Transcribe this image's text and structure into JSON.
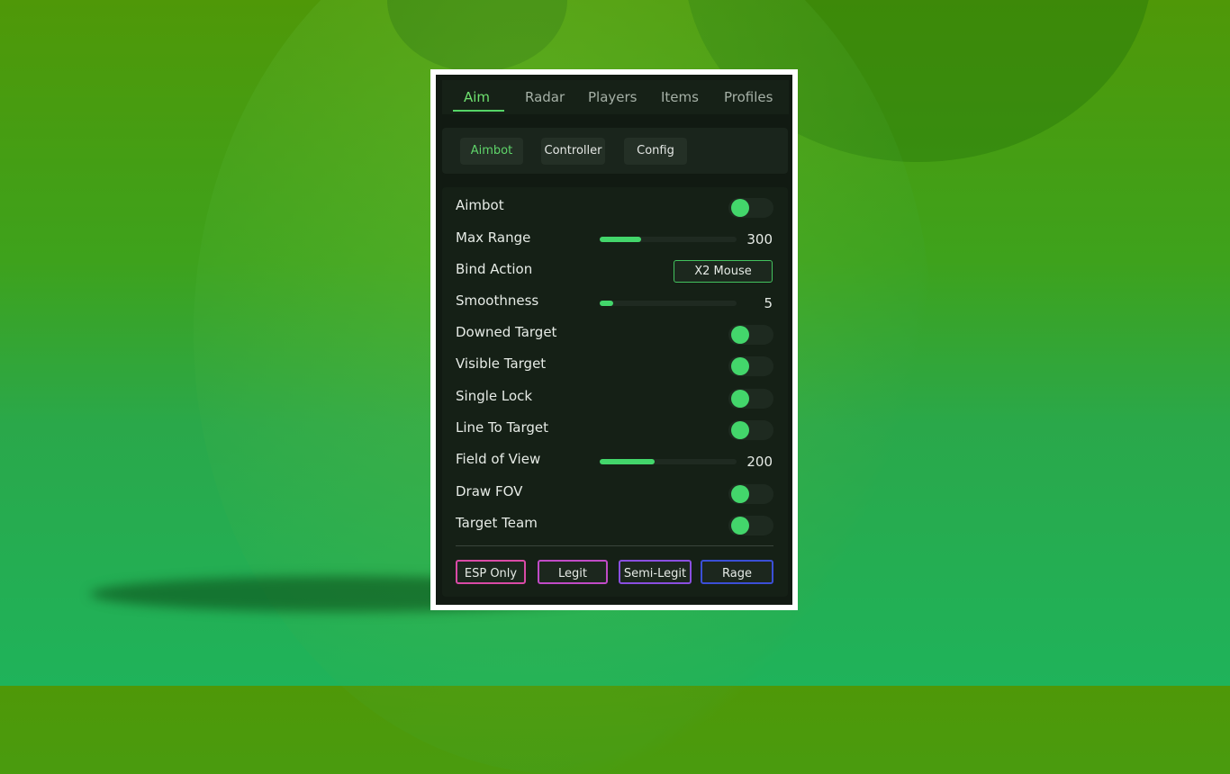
{
  "tabs": [
    {
      "label": "Aim",
      "active": true
    },
    {
      "label": "Radar",
      "active": false
    },
    {
      "label": "Players",
      "active": false
    },
    {
      "label": "Items",
      "active": false
    },
    {
      "label": "Profiles",
      "active": false
    }
  ],
  "subtabs": [
    {
      "label": "Aimbot",
      "active": true
    },
    {
      "label": "Controller",
      "active": false
    },
    {
      "label": "Config",
      "active": false
    }
  ],
  "settings": {
    "aimbot": {
      "label": "Aimbot",
      "enabled": true
    },
    "max_range": {
      "label": "Max Range",
      "value": "300",
      "fill_fraction": 0.3
    },
    "bind_action": {
      "label": "Bind Action",
      "value": "X2 Mouse"
    },
    "smoothness": {
      "label": "Smoothness",
      "value": "5",
      "fill_fraction": 0.1
    },
    "downed_target": {
      "label": "Downed Target",
      "enabled": true
    },
    "visible_target": {
      "label": "Visible Target",
      "enabled": true
    },
    "single_lock": {
      "label": "Single Lock",
      "enabled": true
    },
    "line_to_target": {
      "label": "Line To Target",
      "enabled": true
    },
    "field_of_view": {
      "label": "Field of View",
      "value": "200",
      "fill_fraction": 0.4
    },
    "draw_fov": {
      "label": "Draw FOV",
      "enabled": true
    },
    "target_team": {
      "label": "Target Team",
      "enabled": true
    }
  },
  "presets": [
    {
      "label": "ESP Only",
      "border_color": "#d94aa6"
    },
    {
      "label": "Legit",
      "border_color": "#c04bc6"
    },
    {
      "label": "Semi-Legit",
      "border_color": "#8a4fe0"
    },
    {
      "label": "Rage",
      "border_color": "#3b4fd6"
    }
  ],
  "colors": {
    "accent": "#43d66b",
    "panel": "#111a12"
  }
}
